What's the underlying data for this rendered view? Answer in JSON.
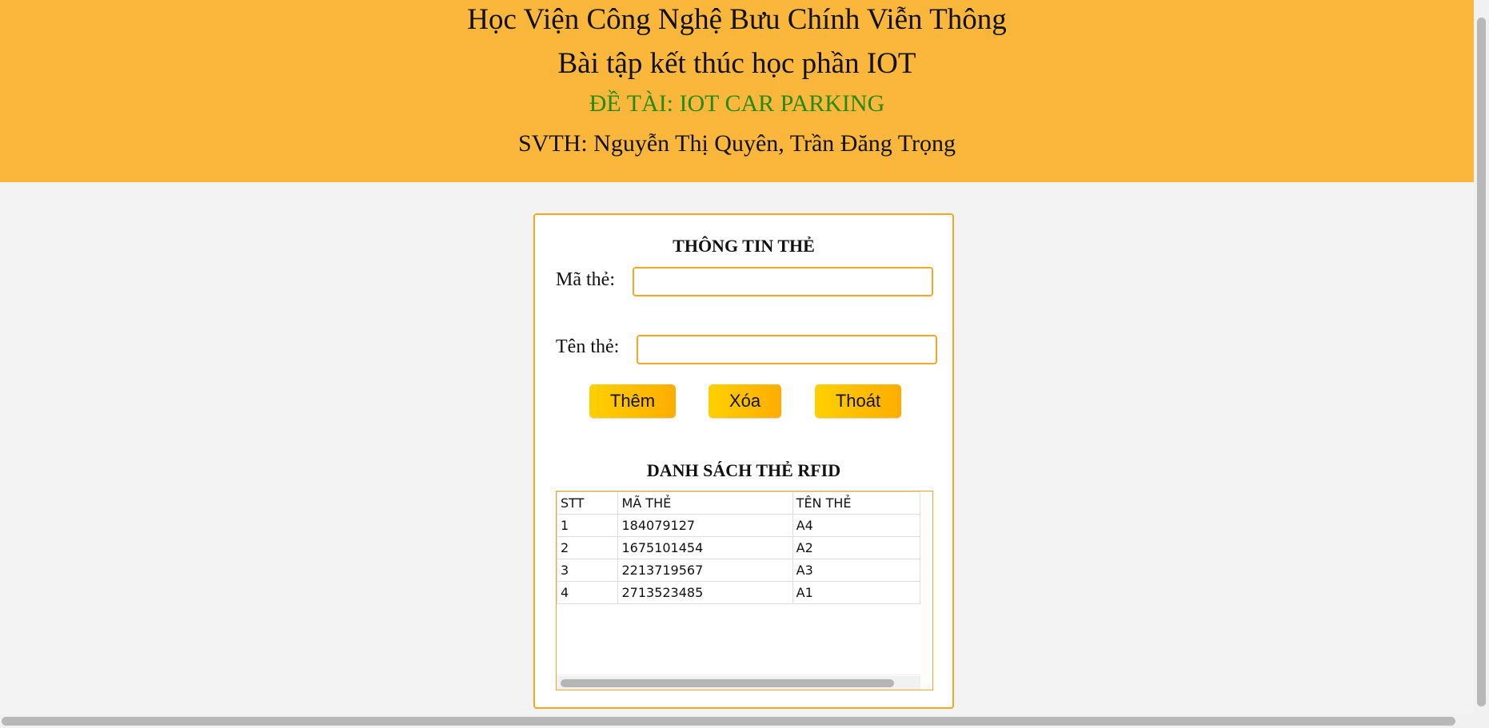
{
  "header": {
    "line1": "Học Viện Công Nghệ Bưu Chính Viễn Thông",
    "line2": "Bài tập kết thúc học phần IOT",
    "line3": "ĐỀ TÀI: IOT CAR PARKING",
    "line4": "SVTH: Nguyễn Thị Quyên, Trần Đăng Trọng"
  },
  "colors": {
    "header_bg": "#fab73b",
    "subtitle_green": "#238a12",
    "accent_border": "#f7a623",
    "button_gradient_start": "#ffd000",
    "button_gradient_end": "#ffad00",
    "page_bg": "#f3f3f3"
  },
  "form": {
    "title": "THÔNG TIN THẺ",
    "ma_the_label": "Mã thẻ:",
    "ma_the_value": "",
    "ten_the_label": "Tên thẻ:",
    "ten_the_value": "",
    "buttons": {
      "add": "Thêm",
      "delete": "Xóa",
      "exit": "Thoát"
    }
  },
  "list": {
    "title": "DANH SÁCH THẺ RFID",
    "columns": [
      "STT",
      "MÃ THẺ",
      "TÊN THẺ"
    ],
    "rows": [
      [
        "1",
        "184079127",
        "A4"
      ],
      [
        "2",
        "1675101454",
        "A2"
      ],
      [
        "3",
        "2213719567",
        "A3"
      ],
      [
        "4",
        "2713523485",
        "A1"
      ]
    ]
  }
}
